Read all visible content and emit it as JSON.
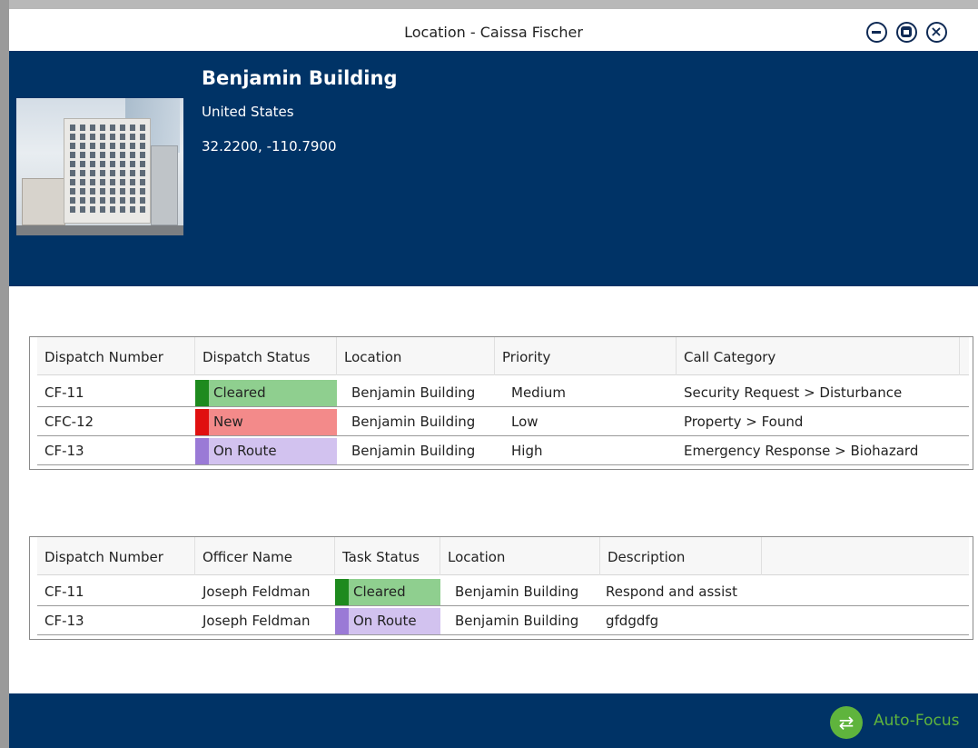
{
  "window": {
    "title": "Location - Caissa Fischer"
  },
  "location": {
    "name": "Benjamin Building",
    "country": "United States",
    "coordinates": "32.2200, -110.7900"
  },
  "dispatches": {
    "columns": [
      "Dispatch Number",
      "Dispatch Status",
      "Location",
      "Priority",
      "Call Category"
    ],
    "rows": [
      {
        "number": "CF-11",
        "status": "Cleared",
        "status_color": "#1e8a1e",
        "status_bg": "#8fcf8f",
        "location": "Benjamin Building",
        "priority": "Medium",
        "category": "Security Request > Disturbance"
      },
      {
        "number": "CFC-12",
        "status": "New",
        "status_color": "#e01010",
        "status_bg": "#f38a8a",
        "location": "Benjamin Building",
        "priority": "Low",
        "category": "Property > Found"
      },
      {
        "number": "CF-13",
        "status": "On Route",
        "status_color": "#9a7ad6",
        "status_bg": "#d2c2ef",
        "location": "Benjamin Building",
        "priority": "High",
        "category": "Emergency Response > Biohazard"
      }
    ]
  },
  "tasks": {
    "columns": [
      "Dispatch Number",
      "Officer Name",
      "Task Status",
      "Location",
      "Description"
    ],
    "rows": [
      {
        "number": "CF-11",
        "officer": "Joseph Feldman",
        "status": "Cleared",
        "status_color": "#1e8a1e",
        "status_bg": "#8fcf8f",
        "location": "Benjamin Building",
        "description": "Respond and assist"
      },
      {
        "number": "CF-13",
        "officer": "Joseph Feldman",
        "status": "On Route",
        "status_color": "#9a7ad6",
        "status_bg": "#d2c2ef",
        "location": "Benjamin Building",
        "description": "gfdgdfg"
      }
    ]
  },
  "footer": {
    "auto_focus_label": "Auto-Focus",
    "auto_focus_icon": "swap-arrows-icon",
    "accent": "#5fb43d"
  },
  "colors": {
    "header_bg": "#003366"
  }
}
